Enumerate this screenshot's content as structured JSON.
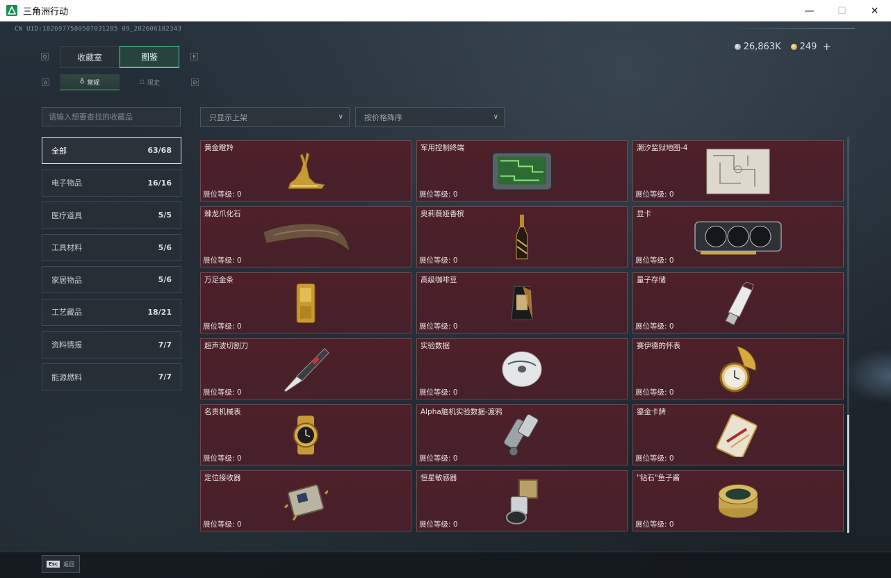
{
  "window": {
    "title": "三角洲行动",
    "minimize": "—",
    "maximize": "☐",
    "close": "✕"
  },
  "uid": "CN UID:1826977580507031285 09_202606182343",
  "currency": {
    "silver": "26,863K",
    "gold": "249",
    "plus": "+"
  },
  "tabs": {
    "key_left": "Q",
    "key_right": "E",
    "items": [
      {
        "label": "收藏室",
        "active": false
      },
      {
        "label": "图鉴",
        "active": true
      }
    ]
  },
  "subtabs": {
    "key_left": "A",
    "key_right": "D",
    "items": [
      {
        "label": "常规",
        "icon": "♁",
        "active": true
      },
      {
        "label": "限定",
        "icon": "☖",
        "active": false
      }
    ]
  },
  "search": {
    "placeholder": "请输入想要查找的收藏品"
  },
  "filters": {
    "listed": "只显示上架",
    "sort": "按价格降序",
    "chevron": "∨"
  },
  "categories": [
    {
      "label": "全部",
      "count": "63/68",
      "active": true
    },
    {
      "label": "电子物品",
      "count": "16/16",
      "active": false
    },
    {
      "label": "医疗道具",
      "count": "5/5",
      "active": false
    },
    {
      "label": "工具材料",
      "count": "5/6",
      "active": false
    },
    {
      "label": "家居物品",
      "count": "5/6",
      "active": false
    },
    {
      "label": "工艺藏品",
      "count": "18/21",
      "active": false
    },
    {
      "label": "资料情报",
      "count": "7/7",
      "active": false
    },
    {
      "label": "能源燃料",
      "count": "7/7",
      "active": false
    }
  ],
  "items": [
    {
      "name": "黄金瞪羚",
      "level": "展位等级: 0",
      "icon": "gazelle"
    },
    {
      "name": "军用控制终端",
      "level": "展位等级: 0",
      "icon": "terminal"
    },
    {
      "name": "潮汐监狱地图-4",
      "level": "展位等级: 0",
      "icon": "map"
    },
    {
      "name": "棘龙爪化石",
      "level": "展位等级: 0",
      "icon": "claw"
    },
    {
      "name": "奥莉薇娅香槟",
      "level": "展位等级: 0",
      "icon": "champagne"
    },
    {
      "name": "显卡",
      "level": "展位等级: 0",
      "icon": "gpu"
    },
    {
      "name": "万足金条",
      "level": "展位等级: 0",
      "icon": "goldbar"
    },
    {
      "name": "高级咖啡豆",
      "level": "展位等级: 0",
      "icon": "coffee"
    },
    {
      "name": "量子存储",
      "level": "展位等级: 0",
      "icon": "usb"
    },
    {
      "name": "超声波切割刀",
      "level": "展位等级: 0",
      "icon": "knife"
    },
    {
      "name": "实验数据",
      "level": "展位等级: 0",
      "icon": "disc"
    },
    {
      "name": "赛伊德的怀表",
      "level": "展位等级: 0",
      "icon": "pocketwatch"
    },
    {
      "name": "名贵机械表",
      "level": "展位等级: 0",
      "icon": "wristwatch"
    },
    {
      "name": "Alpha脑机实验数据-渡鸦",
      "level": "展位等级: 0",
      "icon": "brainchip"
    },
    {
      "name": "鎏金卡牌",
      "level": "展位等级: 0",
      "icon": "card"
    },
    {
      "name": "定位接收器",
      "level": "展位等级: 0",
      "icon": "receiver"
    },
    {
      "name": "恒星敏感器",
      "level": "展位等级: 0",
      "icon": "sensor"
    },
    {
      "name": "\"钻石\"鱼子酱",
      "level": "展位等级: 0",
      "icon": "caviar"
    }
  ],
  "esc": {
    "key": "Esc",
    "label": "返回"
  }
}
